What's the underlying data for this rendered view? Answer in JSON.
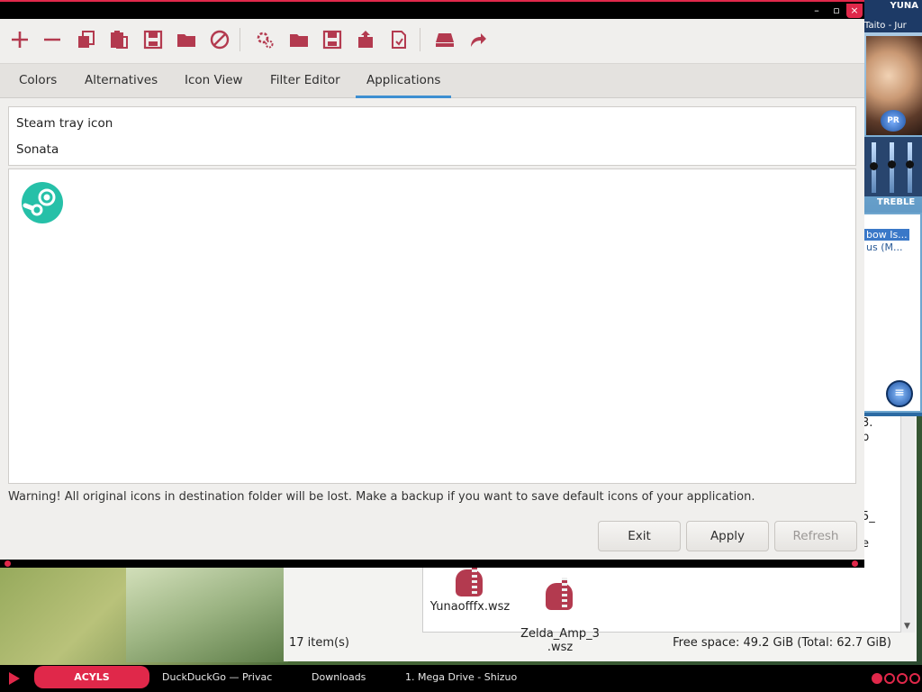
{
  "window": {
    "title_controls": {
      "minimize": "–",
      "maximize": "▫",
      "close": "×"
    }
  },
  "toolbar": {
    "icons": [
      "plus-icon",
      "minus-icon",
      "copy-icon",
      "paste-icon",
      "save-icon",
      "folder-icon",
      "cancel-icon",
      "settings-icon",
      "open-folder-icon",
      "save-as-icon",
      "export-icon",
      "import-icon",
      "drive-icon",
      "redo-icon"
    ],
    "accent": "#b33a4f"
  },
  "tabs": [
    {
      "label": "Colors"
    },
    {
      "label": "Alternatives"
    },
    {
      "label": "Icon View"
    },
    {
      "label": "Filter Editor"
    },
    {
      "label": "Applications",
      "active": true
    }
  ],
  "applications": [
    "Steam tray icon",
    "Sonata"
  ],
  "icon_view": {
    "items": [
      "steam-icon"
    ]
  },
  "warning": "Warning! All original icons in destination folder will be lost. Make a backup if you want to save default icons of your application.",
  "buttons": {
    "exit": "Exit",
    "apply": "Apply",
    "refresh": "Refresh"
  },
  "player": {
    "brand": "YUNA",
    "title": "Taito - Jur",
    "pr": "PR",
    "treble": "TREBLE",
    "playlist_line1": "bow Is...",
    "playlist_line2": "us (M...",
    "menu": "≡"
  },
  "file_manager": {
    "files": [
      "Yunaofffx.wsz",
      "Zelda_Amp_3\n.wsz"
    ],
    "cut_text": [
      "3.",
      "b",
      "5_",
      "e"
    ],
    "status_count": "17 item(s)",
    "status_free": "Free space: 49.2 GiB (Total: 62.7 GiB)"
  },
  "taskbar": {
    "start": "ACYLS",
    "tasks": [
      "DuckDuckGo — Privac",
      "Downloads",
      "1. Mega Drive - Shizuo"
    ]
  },
  "colors": {
    "accent_red": "#e0284a",
    "tab_underline": "#3d8fd1",
    "steam_teal": "#26c0a8"
  }
}
